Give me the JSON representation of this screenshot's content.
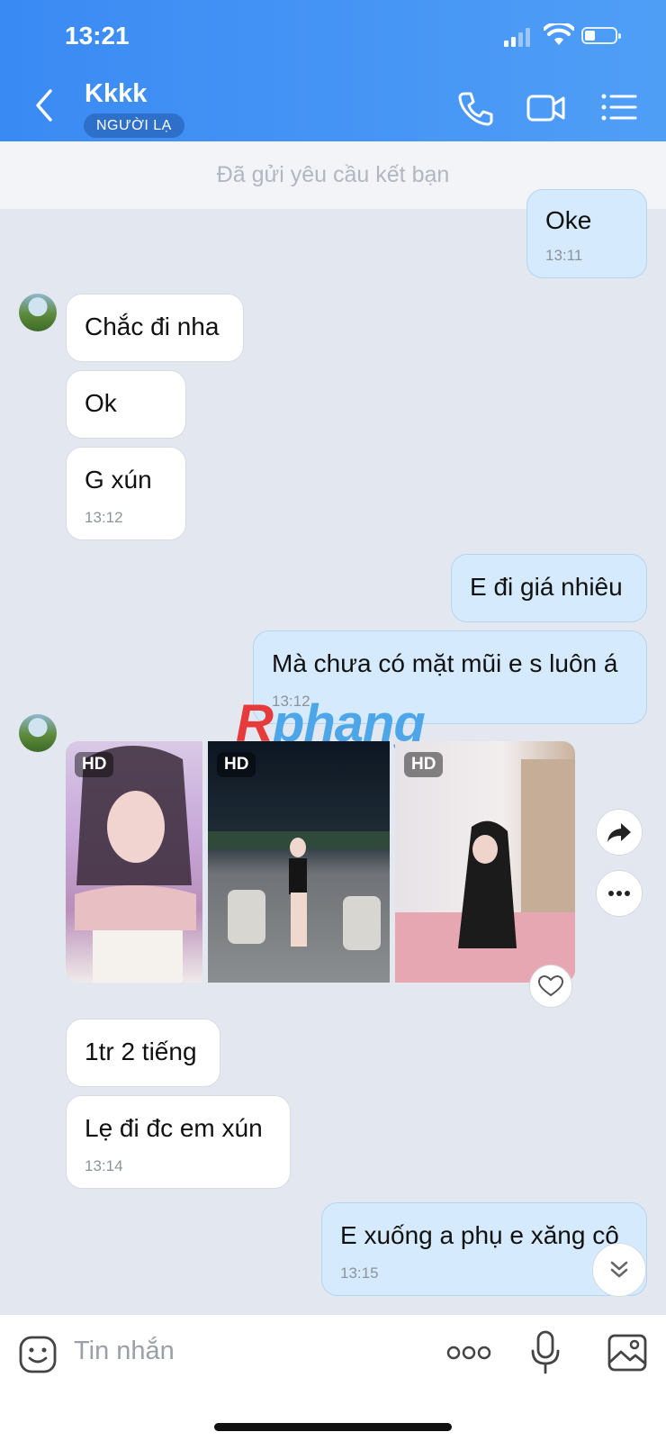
{
  "status_bar": {
    "time": "13:21"
  },
  "header": {
    "contact_name": "Kkkk",
    "badge": "NGƯỜI LẠ"
  },
  "banner": {
    "text": "Đã gửi yêu cầu kết bạn"
  },
  "messages": [
    {
      "text": "Oke",
      "time": "13:11"
    },
    {
      "text": "Chắc đi nha"
    },
    {
      "text": "Ok"
    },
    {
      "text": "G xún",
      "time": "13:12"
    },
    {
      "text": "E đi giá nhiêu"
    },
    {
      "text": "Mà chưa có mặt mũi e s luôn á",
      "time": "13:12"
    },
    {
      "text": "1tr 2 tiếng"
    },
    {
      "text": "Lẹ đi đc em xún",
      "time": "13:14"
    },
    {
      "text": "E xuống a phụ e xăng cô",
      "time": "13:15"
    }
  ],
  "photos": {
    "hd_labels": [
      "HD",
      "HD",
      "HD"
    ]
  },
  "watermark": {
    "part1": "R",
    "part2": "phang"
  },
  "input": {
    "placeholder": "Tin nhắn"
  },
  "colors": {
    "header": "#3a8af4",
    "outgoing_bubble": "#d5eafc",
    "incoming_bubble": "#ffffff",
    "background": "#e3e7ef"
  }
}
